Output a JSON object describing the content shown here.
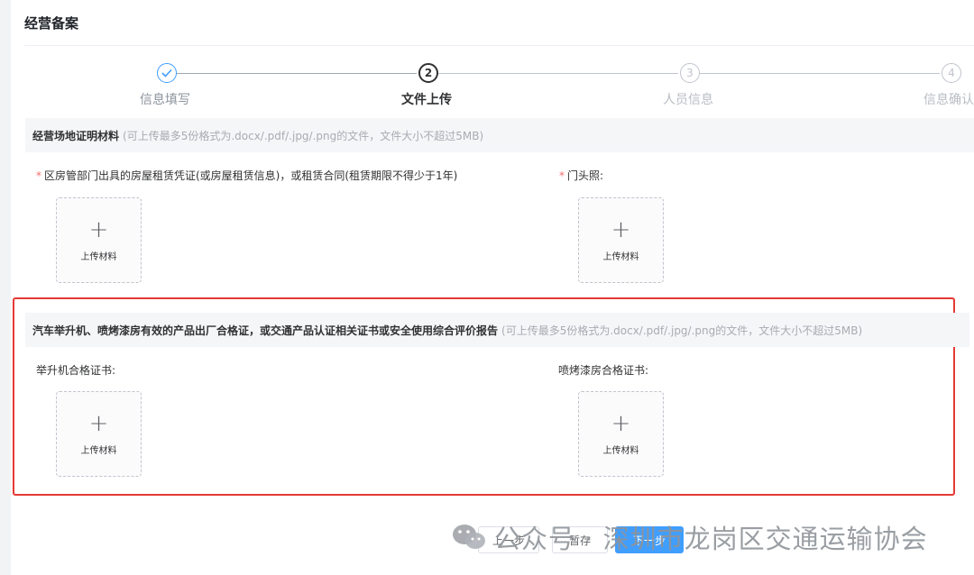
{
  "page": {
    "title": "经营备案"
  },
  "steps": [
    {
      "label": "信息填写",
      "number": "1",
      "status": "finish"
    },
    {
      "label": "文件上传",
      "number": "2",
      "status": "process"
    },
    {
      "label": "人员信息",
      "number": "3",
      "status": "wait"
    },
    {
      "label": "信息确认",
      "number": "4",
      "status": "wait"
    }
  ],
  "section1": {
    "title": "经营场地证明材料",
    "hint": "(可上传最多5份格式为.docx/.pdf/.jpg/.png的文件，文件大小不超过5MB)",
    "fields": [
      {
        "required_mark": "*",
        "label": "区房管部门出具的房屋租赁凭证(或房屋租赁信息)，或租赁合同(租赁期限不得少于1年)",
        "upload_text": "上传材料"
      },
      {
        "required_mark": "*",
        "label": "门头照:",
        "upload_text": "上传材料"
      }
    ]
  },
  "section2": {
    "title": "汽车举升机、喷烤漆房有效的产品出厂合格证，或交通产品认证相关证书或安全使用综合评价报告",
    "hint": "(可上传最多5份格式为.docx/.pdf/.jpg/.png的文件，文件大小不超过5MB)",
    "fields": [
      {
        "label": "举升机合格证书:",
        "upload_text": "上传材料"
      },
      {
        "label": "喷烤漆房合格证书:",
        "upload_text": "上传材料"
      }
    ]
  },
  "footer": {
    "prev_label": "上一步",
    "save_label": "暂存",
    "next_label": "下一步"
  },
  "watermark": {
    "text": "公众号 · 深圳市龙岗区交通运输协会"
  },
  "colors": {
    "primary": "#409eff",
    "highlight": "#e53935",
    "required": "#f56c6c"
  },
  "icons": {
    "step_finish": "check-icon",
    "upload": "plus-icon",
    "watermark_logo": "wechat-icon"
  }
}
